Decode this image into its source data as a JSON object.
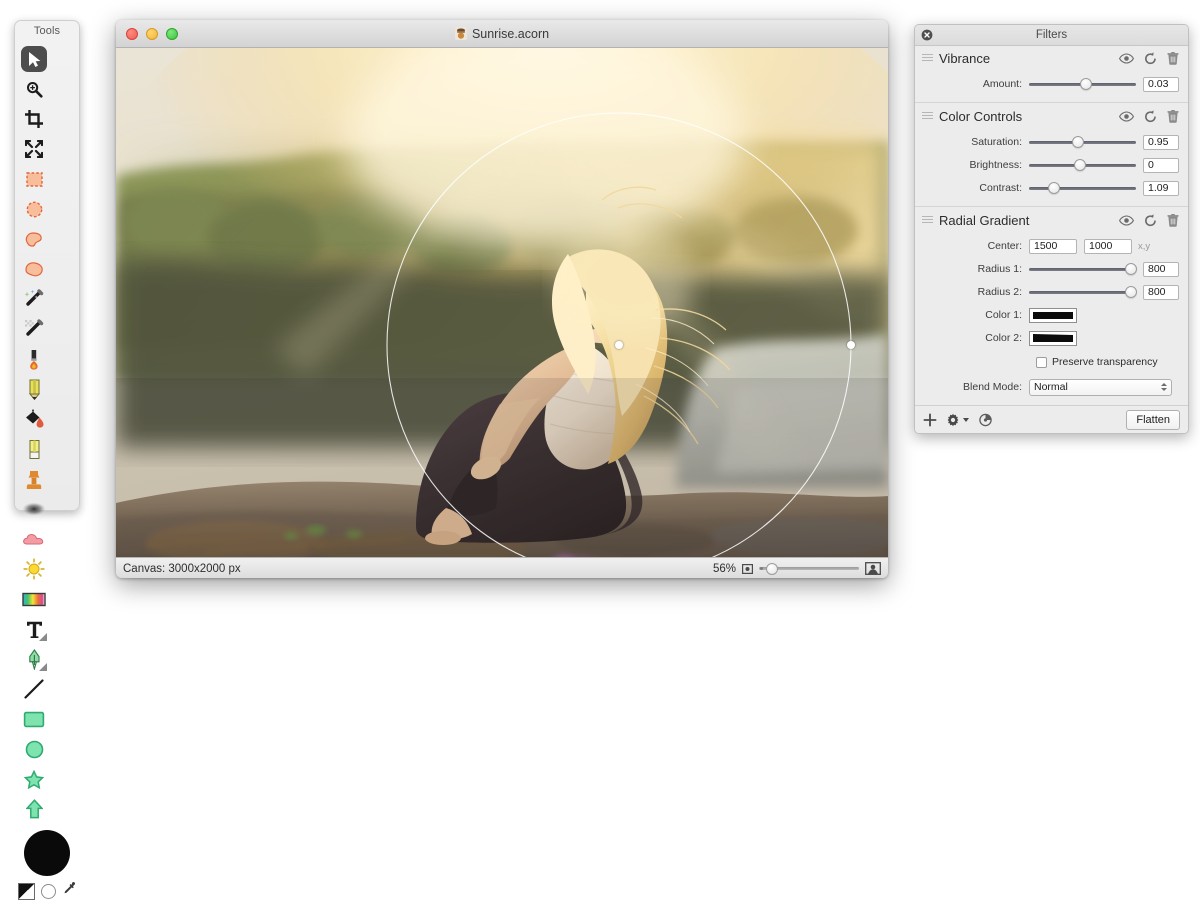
{
  "tools_palette": {
    "title": "Tools",
    "tools": [
      {
        "name": "move-tool",
        "label": "Move",
        "selected": true
      },
      {
        "name": "zoom-tool",
        "label": "Zoom",
        "selected": false
      },
      {
        "name": "crop-tool",
        "label": "Crop",
        "selected": false
      },
      {
        "name": "transform-tool",
        "label": "Transform",
        "selected": false
      },
      {
        "name": "rectangle-select-tool",
        "label": "Rectangular Selection",
        "selected": false
      },
      {
        "name": "ellipse-select-tool",
        "label": "Elliptical Selection",
        "selected": false
      },
      {
        "name": "polygon-lasso-tool",
        "label": "Polygon Lasso",
        "selected": false
      },
      {
        "name": "freehand-lasso-tool",
        "label": "Freehand Lasso",
        "selected": false
      },
      {
        "name": "magic-wand-tool",
        "label": "Magic Wand",
        "selected": false
      },
      {
        "name": "instant-alpha-tool",
        "label": "Instant Alpha",
        "selected": false
      },
      {
        "name": "brush-tool",
        "label": "Brush",
        "selected": false
      },
      {
        "name": "pencil-tool",
        "label": "Pencil",
        "selected": false
      },
      {
        "name": "paint-bucket-tool",
        "label": "Paint Bucket",
        "selected": false
      },
      {
        "name": "eraser-tool",
        "label": "Eraser",
        "selected": false
      },
      {
        "name": "clone-stamp-tool",
        "label": "Clone Stamp",
        "selected": false
      },
      {
        "name": "smudge-tool",
        "label": "Smudge",
        "selected": false
      },
      {
        "name": "dodge-tool",
        "label": "Dodge",
        "selected": false
      },
      {
        "name": "burn-tool",
        "label": "Burn",
        "selected": false
      },
      {
        "name": "gradient-tool",
        "label": "Gradient",
        "selected": false
      },
      {
        "name": "text-tool",
        "label": "Text",
        "selected": false
      },
      {
        "name": "bezier-pen-tool",
        "label": "Bezier Pen",
        "selected": false
      },
      {
        "name": "line-tool",
        "label": "Line",
        "selected": false
      },
      {
        "name": "rectangle-shape-tool",
        "label": "Rectangle",
        "selected": false
      },
      {
        "name": "ellipse-shape-tool",
        "label": "Ellipse",
        "selected": false
      },
      {
        "name": "star-shape-tool",
        "label": "Star",
        "selected": false
      },
      {
        "name": "arrow-shape-tool",
        "label": "Arrow",
        "selected": false
      }
    ],
    "color_well_hex": "#0a0a0a",
    "swatches": [
      {
        "name": "fill-stroke-swatch",
        "label": "Fill and Stroke"
      },
      {
        "name": "white-color-swatch",
        "label": "White"
      },
      {
        "name": "eyedropper-icon",
        "label": "Eyedropper"
      }
    ]
  },
  "document_window": {
    "title": "Sunrise.acorn",
    "traffic_lights": [
      {
        "name": "close-button",
        "color": "#ef5f54"
      },
      {
        "name": "minimize-button",
        "color": "#f3b63a"
      },
      {
        "name": "zoom-button",
        "color": "#3fc43f"
      }
    ],
    "statusbar": {
      "canvas_info": "Canvas: 3000x2000 px",
      "zoom_percent": "56%"
    }
  },
  "filters_panel": {
    "title": "Filters",
    "row_icons": [
      "eye-icon",
      "reset-icon",
      "trash-icon"
    ],
    "filters": [
      {
        "name": "Vibrance",
        "rows": [
          {
            "label": "Amount:",
            "value": "0.03",
            "control": "slider",
            "knob_pct": 53
          }
        ]
      },
      {
        "name": "Color Controls",
        "rows": [
          {
            "label": "Saturation:",
            "value": "0.95",
            "control": "slider",
            "knob_pct": 46
          },
          {
            "label": "Brightness:",
            "value": "0",
            "control": "slider",
            "knob_pct": 48
          },
          {
            "label": "Contrast:",
            "value": "1.09",
            "control": "slider",
            "knob_pct": 23
          }
        ]
      },
      {
        "name": "Radial Gradient",
        "rows": [
          {
            "label": "Center:",
            "control": "xy",
            "value_x": "1500",
            "value_y": "1000",
            "suffix": "x,y"
          },
          {
            "label": "Radius 1:",
            "value": "800",
            "control": "slider",
            "knob_pct": 95
          },
          {
            "label": "Radius 2:",
            "value": "800",
            "control": "slider",
            "knob_pct": 95
          },
          {
            "label": "Color 1:",
            "control": "color",
            "swatch": "solid-black"
          },
          {
            "label": "Color 2:",
            "control": "color",
            "swatch": "black-to-white-gradient"
          }
        ],
        "checkbox": {
          "label": "Preserve transparency",
          "checked": false
        },
        "blend": {
          "label": "Blend Mode:",
          "value": "Normal"
        }
      }
    ],
    "footer": {
      "icons": [
        "plus-icon",
        "gear-icon",
        "chevron-down-icon",
        "presets-icon"
      ],
      "flatten_label": "Flatten"
    }
  }
}
